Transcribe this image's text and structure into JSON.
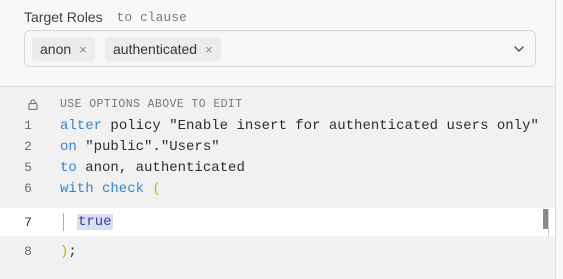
{
  "form": {
    "title": "Target Roles",
    "clause_hint": "to clause",
    "roles": [
      "anon",
      "authenticated"
    ],
    "remove_glyph": "×"
  },
  "editor": {
    "info_text": "USE OPTIONS ABOVE TO EDIT",
    "lines": [
      {
        "num": "1",
        "tokens": [
          {
            "t": "alter",
            "c": "kw"
          },
          {
            "t": " policy \"Enable insert for authenticated users only\"",
            "c": ""
          }
        ]
      },
      {
        "num": "2",
        "tokens": [
          {
            "t": "on",
            "c": "kw"
          },
          {
            "t": " \"public\".\"Users\"",
            "c": ""
          }
        ]
      },
      {
        "num": "5",
        "tokens": [
          {
            "t": "to",
            "c": "kw"
          },
          {
            "t": " anon, authenticated",
            "c": ""
          }
        ]
      },
      {
        "num": "6",
        "tokens": [
          {
            "t": "with check",
            "c": "kw"
          },
          {
            "t": " ",
            "c": ""
          },
          {
            "t": "(",
            "c": "paren"
          }
        ]
      }
    ],
    "active_line": {
      "num": "7",
      "text": "true"
    },
    "last_line": {
      "num": "8",
      "tokens": [
        {
          "t": ")",
          "c": "paren"
        },
        {
          "t": ";",
          "c": ""
        }
      ]
    }
  },
  "icons": {
    "lock": "lock-icon",
    "chevron": "chevron-down-icon"
  }
}
